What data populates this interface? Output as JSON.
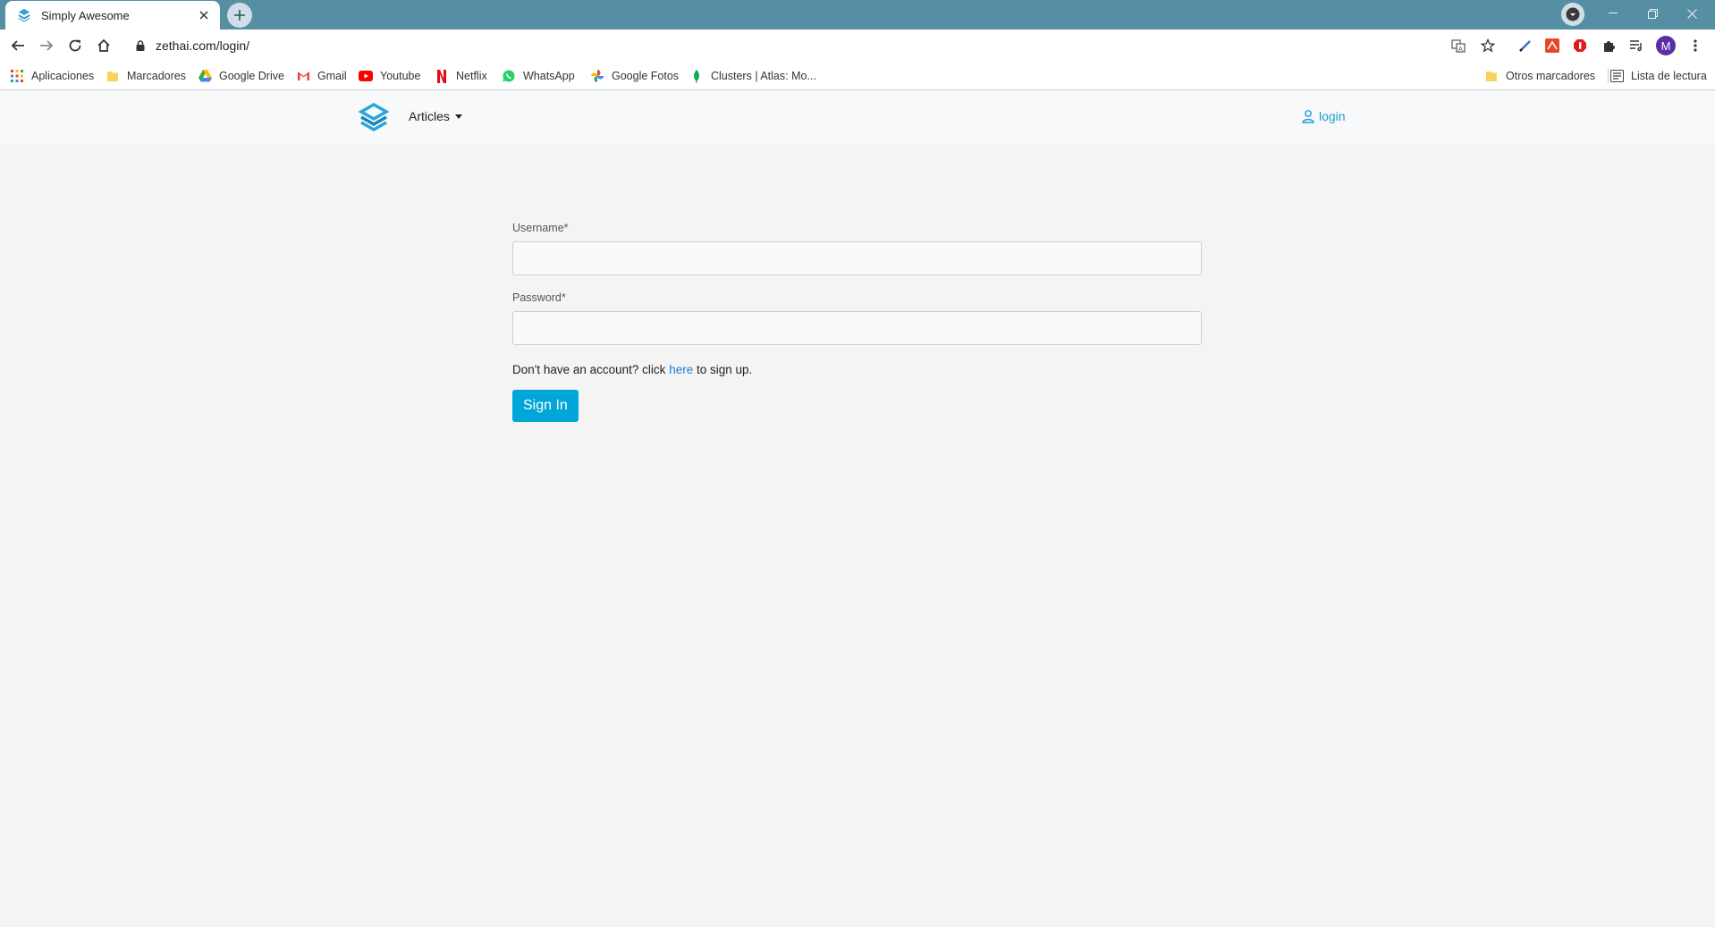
{
  "browser": {
    "tab_title": "Simply Awesome",
    "url": "zethai.com/login/",
    "profile_initial": "M"
  },
  "bookmarks": {
    "left": [
      {
        "label": "Aplicaciones",
        "icon": "apps-grid-icon"
      },
      {
        "label": "Marcadores",
        "icon": "folder-icon"
      },
      {
        "label": "Google Drive",
        "icon": "google-drive-icon"
      },
      {
        "label": "Gmail",
        "icon": "gmail-icon"
      },
      {
        "label": "Youtube",
        "icon": "youtube-icon"
      },
      {
        "label": "Netflix",
        "icon": "netflix-icon"
      },
      {
        "label": "WhatsApp",
        "icon": "whatsapp-icon"
      },
      {
        "label": "Google Fotos",
        "icon": "google-photos-icon"
      },
      {
        "label": "Clusters | Atlas: Mo...",
        "icon": "mongodb-leaf-icon"
      }
    ],
    "right": [
      {
        "label": "Otros marcadores",
        "icon": "folder-icon"
      },
      {
        "label": "Lista de lectura",
        "icon": "reading-list-icon"
      }
    ]
  },
  "site": {
    "nav_articles": "Articles",
    "nav_login": "login",
    "brand_color": "#1a9fd4"
  },
  "form": {
    "username_label": "Username*",
    "username_value": "",
    "password_label": "Password*",
    "password_value": "",
    "signup_prefix": "Don't have an account? click ",
    "signup_link": "here",
    "signup_suffix": " to sign up.",
    "submit_label": "Sign In",
    "submit_color": "#00a6d8"
  }
}
